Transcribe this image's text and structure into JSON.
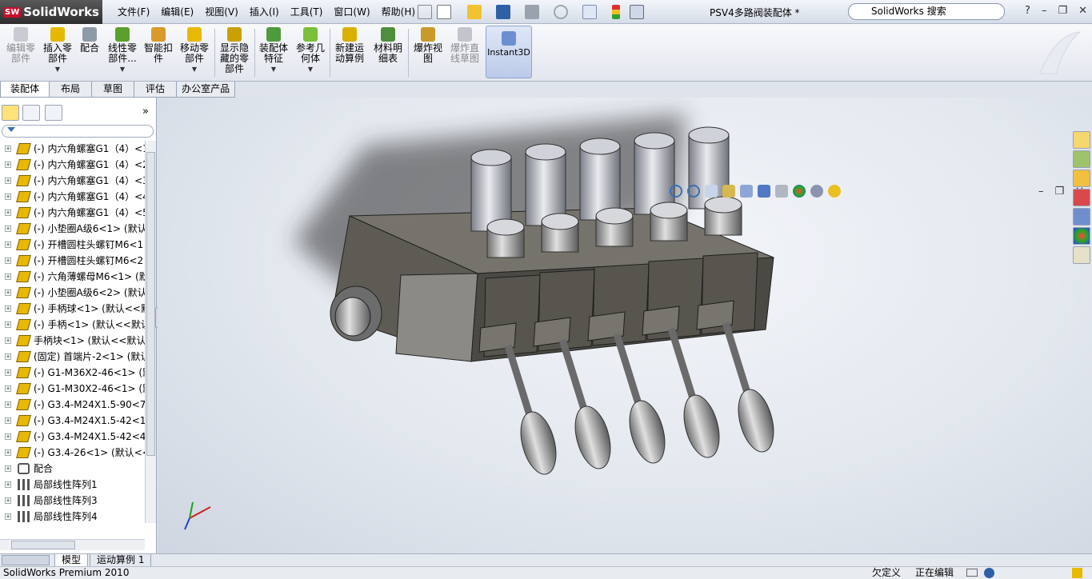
{
  "app": {
    "name": "SolidWorks",
    "doc_title": "PSV4多路阀装配体 *",
    "search_placeholder": "SolidWorks 搜索"
  },
  "menu": [
    "文件(F)",
    "编辑(E)",
    "视图(V)",
    "插入(I)",
    "工具(T)",
    "窗口(W)",
    "帮助(H)"
  ],
  "toolbar_icons": [
    "new-file-icon",
    "open-file-icon",
    "save-icon",
    "print-icon",
    "undo-icon",
    "select-icon",
    "rebuild-icon",
    "options-icon"
  ],
  "commands": [
    {
      "label": "编辑零\n部件",
      "disabled": true
    },
    {
      "label": "插入零\n部件",
      "disabled": false
    },
    {
      "label": "配合",
      "disabled": false
    },
    {
      "label": "线性零\n部件...",
      "disabled": false
    },
    {
      "label": "智能扣\n件",
      "disabled": false
    },
    {
      "label": "移动零\n部件",
      "disabled": false
    },
    {
      "label": "显示隐\n藏的零\n部件",
      "disabled": false
    },
    {
      "label": "装配体\n特征",
      "disabled": false
    },
    {
      "label": "参考几\n何体",
      "disabled": false
    },
    {
      "label": "新建运\n动算例",
      "disabled": false
    },
    {
      "label": "材料明\n细表",
      "disabled": false
    },
    {
      "label": "爆炸视\n图",
      "disabled": false
    },
    {
      "label": "爆炸直\n线草图",
      "disabled": true
    },
    {
      "label": "Instant3D",
      "disabled": false
    }
  ],
  "cmd_tabs": [
    "装配体",
    "布局",
    "草图",
    "评估",
    "办公室产品"
  ],
  "tree": [
    "(-) 内六角螺塞G1（4）<1",
    "(-) 内六角螺塞G1（4）<2",
    "(-) 内六角螺塞G1（4）<3",
    "(-) 内六角螺塞G1（4）<4",
    "(-) 内六角螺塞G1（4）<5",
    "(-) 小垫圈A级6<1> (默认",
    "(-) 开槽圆柱头螺钉M6<1",
    "(-) 开槽圆柱头螺钉M6<2",
    "(-) 六角薄螺母M6<1> (默",
    "(-) 小垫圈A级6<2> (默认",
    "(-) 手柄球<1> (默认<<默",
    "(-) 手柄<1> (默认<<默认",
    "手柄块<1> (默认<<默认",
    "(固定) 首端片-2<1> (默认",
    "(-) G1-M36X2-46<1> (默",
    "(-) G1-M30X2-46<1> (默",
    "(-) G3.4-M24X1.5-90<7:",
    "(-) G3.4-M24X1.5-42<1:",
    "(-) G3.4-M24X1.5-42<4:",
    "(-) G3.4-26<1> (默认<<",
    "配合",
    "局部线性阵列1",
    "局部线性阵列3",
    "局部线性阵列4"
  ],
  "bottom_tabs": [
    "模型",
    "运动算例 1"
  ],
  "status": {
    "product": "SolidWorks Premium 2010",
    "state1": "欠定义",
    "state2": "正在编辑"
  },
  "colors": {
    "part_icon": "#e6b800",
    "accent_blue": "#3a6fb5",
    "body_dark": "#5d5b54"
  }
}
